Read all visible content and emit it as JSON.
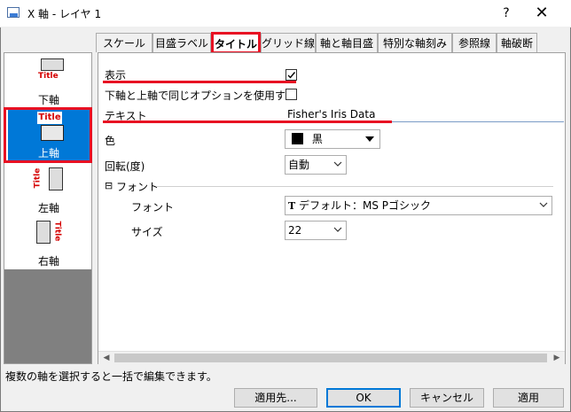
{
  "window": {
    "title": "X 軸 - レイヤ 1",
    "help_label": "?",
    "close_label": "✕"
  },
  "axis_list": {
    "items": [
      {
        "label": "下軸",
        "icon_text": "Title",
        "icon": "bottom-axis-icon",
        "selected": false
      },
      {
        "label": "上軸",
        "icon_text": "Title",
        "icon": "top-axis-icon",
        "selected": true
      },
      {
        "label": "左軸",
        "icon_text": "Title",
        "icon": "left-axis-icon",
        "selected": false
      },
      {
        "label": "右軸",
        "icon_text": "Title",
        "icon": "right-axis-icon",
        "selected": false
      }
    ]
  },
  "tabs": [
    {
      "label": "スケール",
      "active": false
    },
    {
      "label": "目盛ラベル",
      "active": false
    },
    {
      "label": "タイトル",
      "active": true
    },
    {
      "label": "グリッド線",
      "active": false
    },
    {
      "label": "軸と軸目盛",
      "active": false
    },
    {
      "label": "特別な軸刻み",
      "active": false
    },
    {
      "label": "参照線",
      "active": false
    },
    {
      "label": "軸破断",
      "active": false
    }
  ],
  "panel": {
    "show_label": "表示",
    "show_checked": true,
    "same_option_label": "下軸と上軸で同じオプションを使用する",
    "same_option_checked": false,
    "text_label": "テキスト",
    "text_value": "Fisher's Iris Data",
    "color_label": "色",
    "color_value": "黒",
    "color_swatch": "#000000",
    "rotation_label": "回転(度)",
    "rotation_value": "自動",
    "font_section_toggle": "⊟",
    "font_section_label": "フォント",
    "font_label": "フォント",
    "font_value": "デフォルト：MS Pゴシック",
    "font_icon": "truetype-icon",
    "size_label": "サイズ",
    "size_value": "22"
  },
  "status_text": "複数の軸を選択すると一括で編集できます。",
  "buttons": {
    "apply_to": "適用先...",
    "ok": "OK",
    "cancel": "キャンセル",
    "apply": "適用"
  },
  "colors": {
    "highlight_red": "#e81123",
    "selection_blue": "#0078d7"
  }
}
